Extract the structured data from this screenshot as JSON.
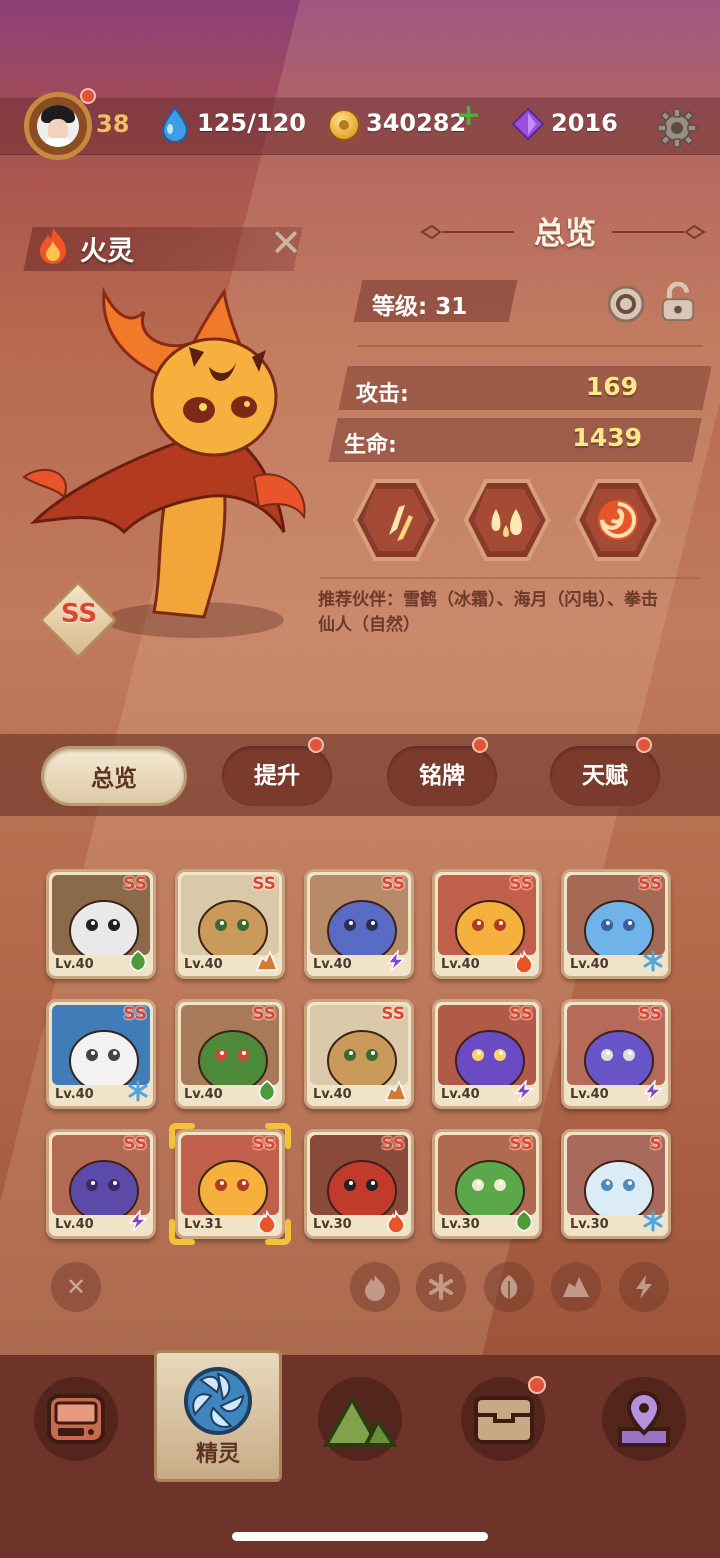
{
  "player": {
    "level": "38"
  },
  "resources": {
    "stamina": "125/120",
    "gold": "340282",
    "gems": "2016"
  },
  "pet": {
    "name": "火灵",
    "rank": "SS"
  },
  "overview": {
    "title": "总览",
    "level_label": "等级: 31",
    "attack_label": "攻击:",
    "attack_value": "169",
    "hp_label": "生命:",
    "hp_value": "1439",
    "partners": "推荐伙伴：雪鹤（冰霜）、海月（闪电）、拳击仙人（自然）"
  },
  "tabs": [
    {
      "label": "总览",
      "active": true,
      "badge": false
    },
    {
      "label": "提升",
      "active": false,
      "badge": true
    },
    {
      "label": "铭牌",
      "active": false,
      "badge": true
    },
    {
      "label": "天赋",
      "active": false,
      "badge": true
    }
  ],
  "pets": [
    {
      "lv": "Lv.40",
      "rank": "SS",
      "element": "leaf",
      "icon": "panda"
    },
    {
      "lv": "Lv.40",
      "rank": "SS",
      "element": "earth",
      "icon": "sprout-potato"
    },
    {
      "lv": "Lv.40",
      "rank": "SS",
      "element": "lightning",
      "icon": "cannon-robot"
    },
    {
      "lv": "Lv.40",
      "rank": "SS",
      "element": "fire",
      "icon": "fire-spirit"
    },
    {
      "lv": "Lv.40",
      "rank": "SS",
      "element": "ice",
      "icon": "blue-dragon"
    },
    {
      "lv": "Lv.40",
      "rank": "SS",
      "element": "ice",
      "icon": "owl"
    },
    {
      "lv": "Lv.40",
      "rank": "SS",
      "element": "leaf",
      "icon": "monkey"
    },
    {
      "lv": "Lv.40",
      "rank": "SS",
      "element": "earth",
      "icon": "sprout-potato"
    },
    {
      "lv": "Lv.40",
      "rank": "SS",
      "element": "lightning",
      "icon": "purple-dragon"
    },
    {
      "lv": "Lv.40",
      "rank": "SS",
      "element": "lightning",
      "icon": "cloud-pig"
    },
    {
      "lv": "Lv.40",
      "rank": "SS",
      "element": "lightning",
      "icon": "crocodile"
    },
    {
      "lv": "Lv.31",
      "rank": "SS",
      "element": "fire",
      "icon": "fire-spirit",
      "selected": true
    },
    {
      "lv": "Lv.30",
      "rank": "SS",
      "element": "fire",
      "icon": "bull-warrior"
    },
    {
      "lv": "Lv.30",
      "rank": "SS",
      "element": "leaf",
      "icon": "parrot"
    },
    {
      "lv": "Lv.30",
      "rank": "S",
      "element": "ice",
      "icon": "snow-tiger"
    }
  ],
  "filters": [
    "clear",
    "fire",
    "ice",
    "leaf",
    "earth",
    "lightning"
  ],
  "nav": [
    {
      "icon": "device-icon",
      "label": ""
    },
    {
      "icon": "spirit-icon",
      "label": "精灵",
      "active": true
    },
    {
      "icon": "mountain-icon",
      "label": ""
    },
    {
      "icon": "chest-icon",
      "label": "",
      "badge": true
    },
    {
      "icon": "map-pin-icon",
      "label": ""
    }
  ],
  "colors": {
    "fire": "#e8552a",
    "ice": "#4fa6de",
    "leaf": "#4d9a3a",
    "earth": "#d07a34",
    "lightning": "#8a44c8",
    "rank": "#e0452a",
    "stat": "#ffe88a"
  }
}
